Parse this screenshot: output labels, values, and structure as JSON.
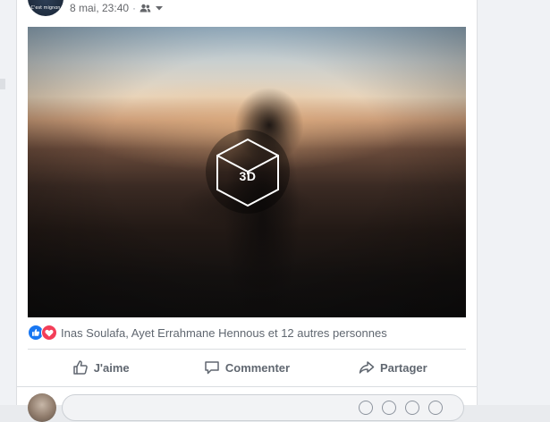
{
  "post": {
    "avatar_text": "C'est mignon",
    "timestamp": "8 mai, 23:40",
    "separator": "·",
    "media_badge": "3D"
  },
  "reactions": {
    "icons": [
      "like-icon",
      "love-icon"
    ],
    "reactors_text": "Inas Soulafa, Ayet Errahmane Hennous et 12 autres personnes"
  },
  "actions": {
    "like_label": "J'aime",
    "comment_label": "Commenter",
    "share_label": "Partager"
  },
  "comment": {
    "placeholder": ""
  },
  "colors": {
    "facebook_blue": "#1877f2",
    "love_red": "#f33e58",
    "action_grey": "#606770"
  }
}
